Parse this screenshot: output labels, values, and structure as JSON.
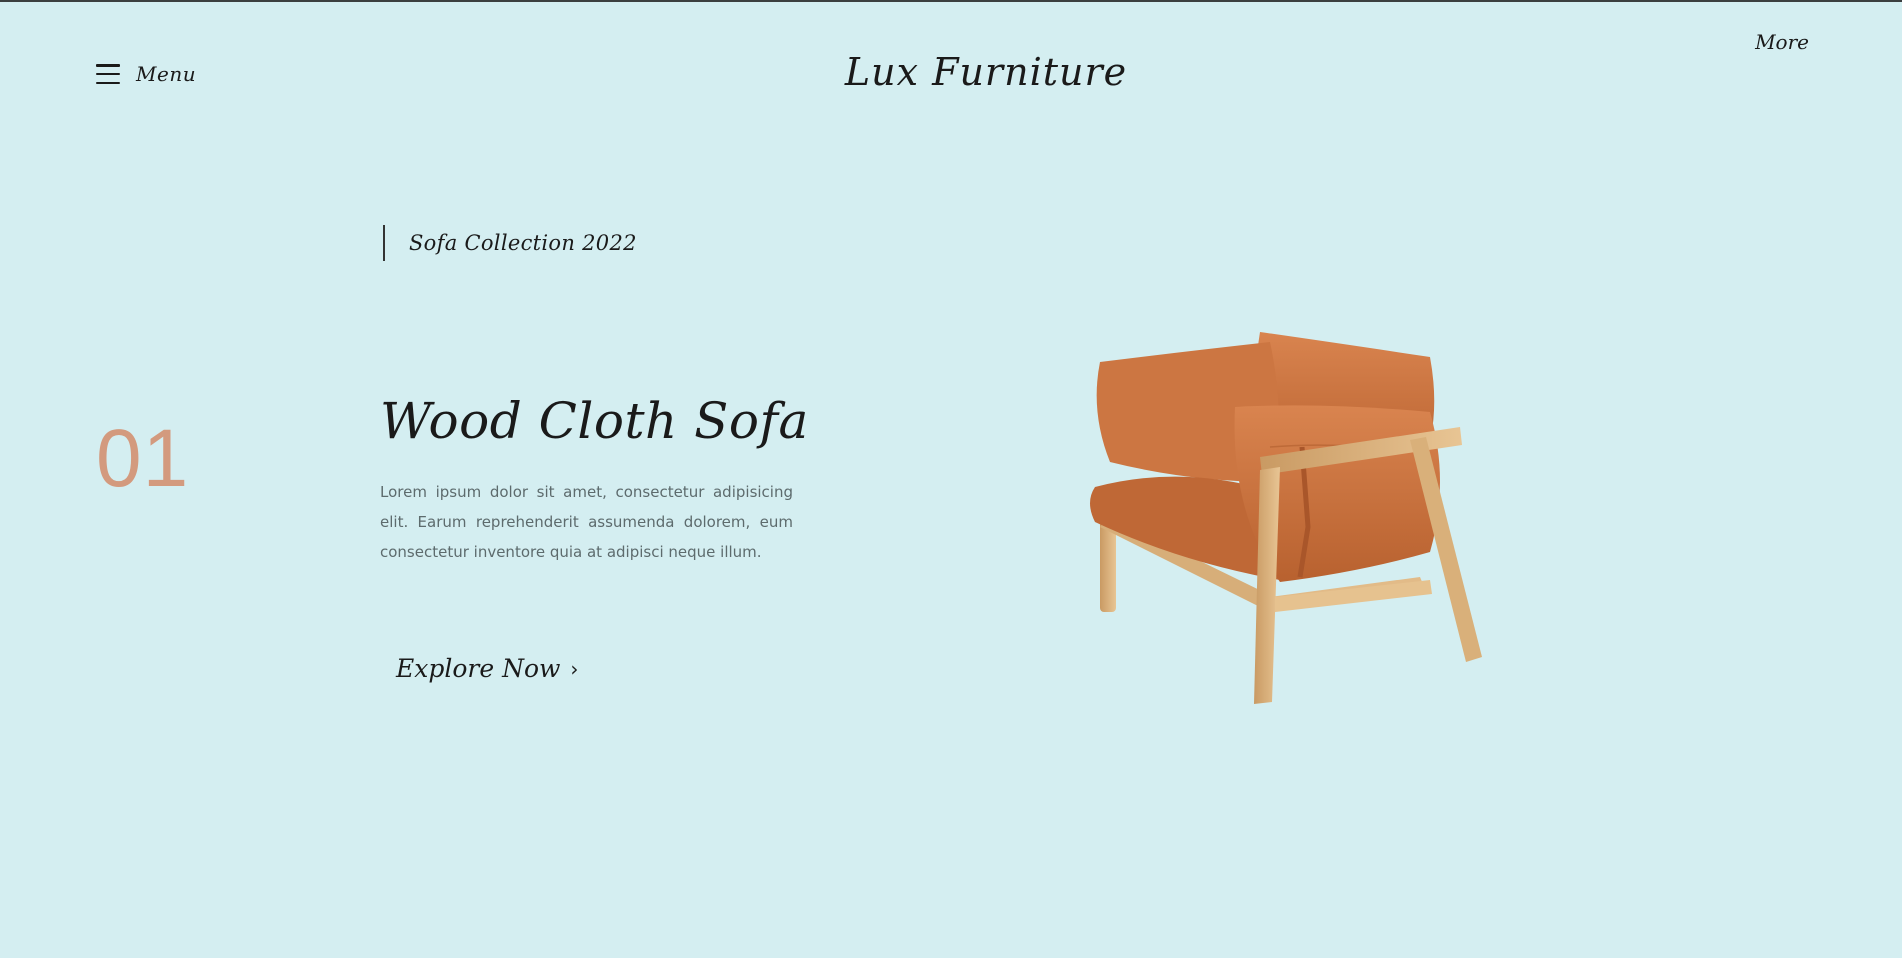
{
  "header": {
    "menu_label": "Menu",
    "brand": "Lux Furniture",
    "more_label": "More"
  },
  "hero": {
    "collection": "Sofa Collection 2022",
    "slide_number": "01",
    "title": "Wood Cloth Sofa",
    "description": "Lorem ipsum dolor sit amet, consectetur adipisicing elit. Earum reprehenderit assumenda dolorem, eum consectetur inventore quia at adipisci neque illum.",
    "cta_label": "Explore Now",
    "cta_icon": "chevron-right-icon"
  },
  "colors": {
    "background": "#d4eef1",
    "accent": "#d39a7e",
    "text": "#1a1a1a",
    "cushion": "#c8703f",
    "wood": "#dcb27e"
  }
}
